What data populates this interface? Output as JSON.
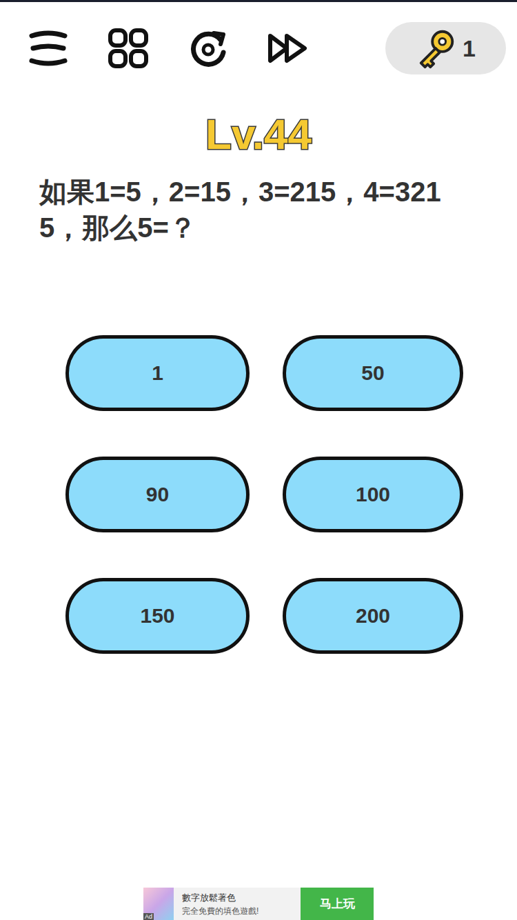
{
  "toolbar": {
    "key_count": "1"
  },
  "level": {
    "title": "Lv.44"
  },
  "question": "如果1=5，2=15，3=215，4=3215，那么5=？",
  "options": [
    {
      "label": "1"
    },
    {
      "label": "50"
    },
    {
      "label": "90"
    },
    {
      "label": "100"
    },
    {
      "label": "150"
    },
    {
      "label": "200"
    }
  ],
  "ad": {
    "badge": "Ad",
    "title": "數字放鬆著色",
    "subtitle": "完全免費的填色遊戲!",
    "button": "马上玩"
  }
}
